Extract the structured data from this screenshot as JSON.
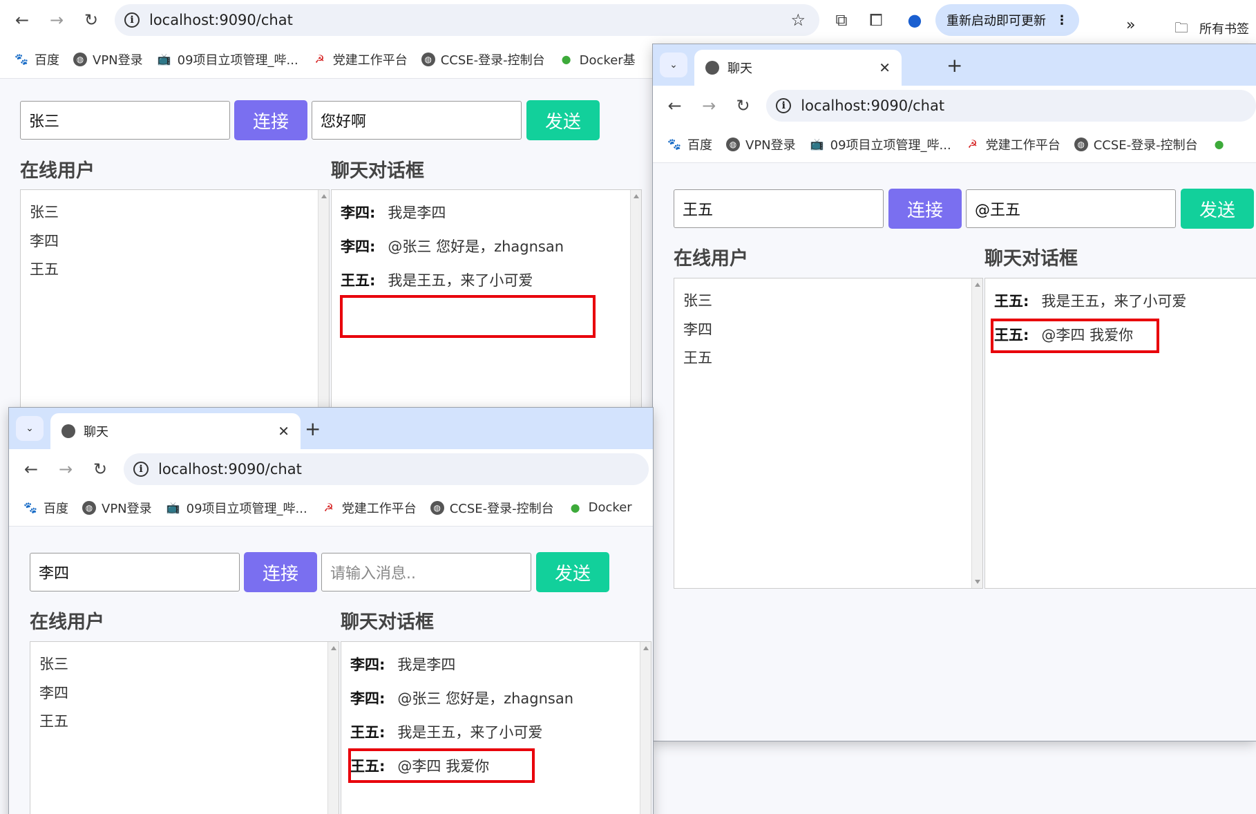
{
  "main_window": {
    "url": "localhost:9090/chat",
    "update_button": "重新启动即可更新",
    "all_bookmarks": "所有书签",
    "bookmarks": [
      "百度",
      "VPN登录",
      "09项目立项管理_哔...",
      "党建工作平台",
      "CCSE-登录-控制台",
      "Docker基"
    ],
    "chat": {
      "username": "张三",
      "connect": "连接",
      "message": "您好啊",
      "send": "发送",
      "online_title": "在线用户",
      "chat_title": "聊天对话框",
      "users": [
        "张三",
        "李四",
        "王五"
      ],
      "messages": [
        {
          "sender": "李四:",
          "text": "我是李四"
        },
        {
          "sender": "李四:",
          "text": "@张三 您好是，zhagnsan"
        },
        {
          "sender": "王五:",
          "text": "我是王五，来了小可爱"
        }
      ]
    }
  },
  "window_lisi": {
    "tab_title": "聊天",
    "url": "localhost:9090/chat",
    "bookmarks": [
      "百度",
      "VPN登录",
      "09项目立项管理_哔...",
      "党建工作平台",
      "CCSE-登录-控制台",
      "Docker"
    ],
    "chat": {
      "username": "李四",
      "connect": "连接",
      "message_placeholder": "请输入消息..",
      "send": "发送",
      "online_title": "在线用户",
      "chat_title": "聊天对话框",
      "users": [
        "张三",
        "李四",
        "王五"
      ],
      "messages": [
        {
          "sender": "李四:",
          "text": "我是李四"
        },
        {
          "sender": "李四:",
          "text": "@张三 您好是，zhagnsan"
        },
        {
          "sender": "王五:",
          "text": "我是王五，来了小可爱"
        },
        {
          "sender": "王五:",
          "text": "@李四 我爱你"
        }
      ]
    }
  },
  "window_wangwu": {
    "tab_title": "聊天",
    "url": "localhost:9090/chat",
    "bookmarks": [
      "百度",
      "VPN登录",
      "09项目立项管理_哔...",
      "党建工作平台",
      "CCSE-登录-控制台"
    ],
    "chat": {
      "username": "王五",
      "connect": "连接",
      "message": "@王五",
      "send": "发送",
      "online_title": "在线用户",
      "chat_title": "聊天对话框",
      "users": [
        "张三",
        "李四",
        "王五"
      ],
      "messages": [
        {
          "sender": "王五:",
          "text": "我是王五，来了小可爱"
        },
        {
          "sender": "王五:",
          "text": "@李四 我爱你"
        }
      ]
    }
  },
  "colors": {
    "connect": "#7a6ff0",
    "send": "#12d09b",
    "highlight": "#e8000b",
    "tabstrip": "#d3e3fd"
  }
}
